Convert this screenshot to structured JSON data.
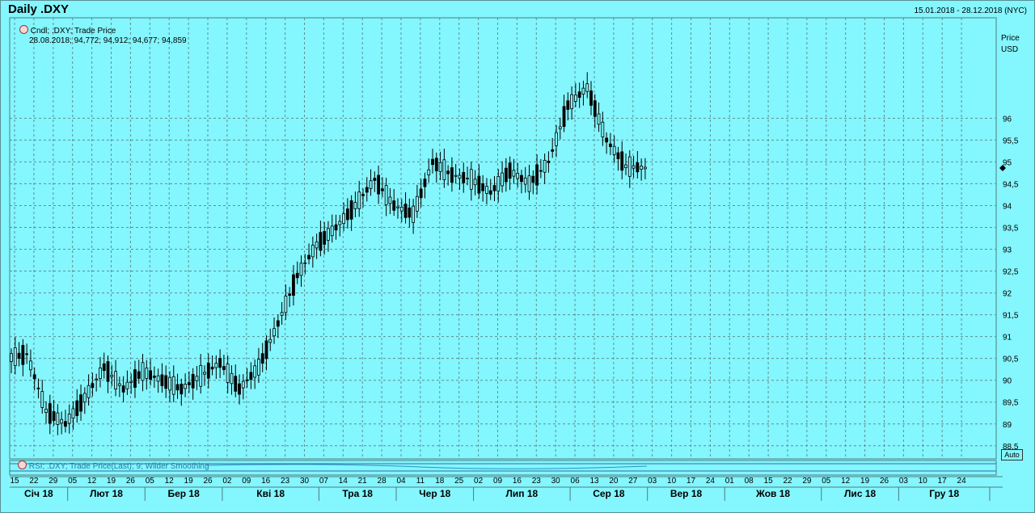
{
  "title": "Daily .DXY",
  "date_range": "15.01.2018 - 28.12.2018 (NYC)",
  "legend": {
    "series_label": "Cndl; .DXY; Trade Price",
    "ohlc_text": "28.08.2018; 94,772; 94,912; 94,677; 94,859"
  },
  "y_axis_title": "Price",
  "y_axis_unit": "USD",
  "rsi_label": "RSI; .DXY; Trade Price(Last); 9; Wilder Smoothing",
  "auto_button": "Auto",
  "chart_data": {
    "type": "candlestick",
    "ylim": [
      88.2,
      98.3
    ],
    "yticks": [
      88.5,
      89,
      89.5,
      90,
      90.5,
      91,
      91.5,
      92,
      92.5,
      93,
      93.5,
      94,
      94.5,
      95,
      95.5,
      96
    ],
    "ytick_labels": [
      "88,5",
      "89",
      "89,5",
      "90",
      "90,5",
      "91",
      "91,5",
      "92",
      "92,5",
      "93",
      "93,5",
      "94",
      "94,5",
      "95",
      "95,5",
      "96"
    ],
    "xticks_day": [
      "15",
      "22",
      "29",
      "05",
      "12",
      "19",
      "26",
      "05",
      "12",
      "19",
      "26",
      "02",
      "09",
      "16",
      "23",
      "30",
      "07",
      "14",
      "21",
      "28",
      "04",
      "11",
      "18",
      "25",
      "02",
      "09",
      "16",
      "23",
      "30",
      "06",
      "13",
      "20",
      "27",
      "03",
      "10",
      "17",
      "24",
      "01",
      "08",
      "15",
      "22",
      "29",
      "05",
      "12",
      "19",
      "26",
      "03",
      "10",
      "17",
      "24"
    ],
    "months": [
      "Січ 18",
      "Лют 18",
      "Бер 18",
      "Кві 18",
      "Тра 18",
      "Чер 18",
      "Лип 18",
      "Сер 18",
      "Вер 18",
      "Жов 18",
      "Лис 18",
      "Гру 18"
    ],
    "candles_weekly_close": [
      90.6,
      89.3,
      89.0,
      89.6,
      90.3,
      89.8,
      90.2,
      90.0,
      89.8,
      90.1,
      90.4,
      89.8,
      90.3,
      91.3,
      92.4,
      93.1,
      93.5,
      94.0,
      94.6,
      94.0,
      93.8,
      95.0,
      94.7,
      94.6,
      94.3,
      94.8,
      94.5,
      95.0,
      96.3,
      96.7,
      95.5,
      94.9,
      94.86
    ]
  }
}
